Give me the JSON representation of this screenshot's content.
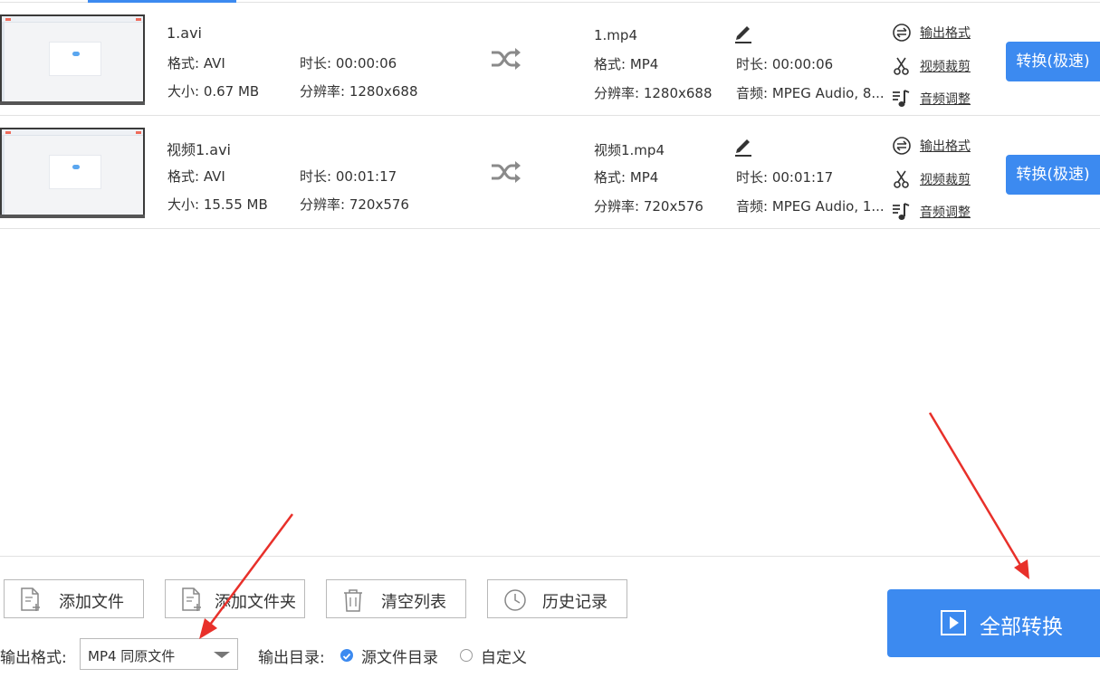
{
  "files": [
    {
      "source_name": "1.avi",
      "source_format": "格式: AVI",
      "source_duration": "时长: 00:00:06",
      "source_size": "大小: 0.67 MB",
      "source_resolution": "分辨率: 1280x688",
      "output_name": "1.mp4",
      "output_format": "格式: MP4",
      "output_duration": "时长: 00:00:06",
      "output_resolution": "分辨率: 1280x688",
      "output_audio": "音频: MPEG Audio, 8...",
      "convert_label": "转换(极速)"
    },
    {
      "source_name": "视频1.avi",
      "source_format": "格式: AVI",
      "source_duration": "时长: 00:01:17",
      "source_size": "大小: 15.55 MB",
      "source_resolution": "分辨率: 720x576",
      "output_name": "视频1.mp4",
      "output_format": "格式: MP4",
      "output_duration": "时长: 00:01:17",
      "output_resolution": "分辨率: 720x576",
      "output_audio": "音频: MPEG Audio, 1...",
      "convert_label": "转换(极速)"
    }
  ],
  "row_actions": {
    "output_format": "输出格式",
    "video_trim": "视频裁剪",
    "audio_adjust": "音频调整"
  },
  "toolbar": {
    "add_file": "添加文件",
    "add_folder": "添加文件夹",
    "clear_list": "清空列表",
    "history": "历史记录",
    "convert_all": "全部转换"
  },
  "output": {
    "format_label": "输出格式:",
    "format_value": "MP4 同原文件",
    "dir_label": "输出目录:",
    "dir_option_source": "源文件目录",
    "dir_option_custom": "自定义",
    "dir_selected": "源文件目录"
  },
  "icons": {
    "shuffle": "shuffle-icon",
    "edit": "pencil-icon",
    "format": "swap-circle-icon",
    "trim": "scissors-icon",
    "audio": "music-note-icon",
    "add_file": "file-plus-icon",
    "add_folder": "file-plus-icon",
    "clear": "trash-icon",
    "history": "clock-icon",
    "play": "play-square-icon"
  },
  "colors": {
    "accent": "#3c8af0",
    "annotation_arrow": "#e8302a"
  }
}
